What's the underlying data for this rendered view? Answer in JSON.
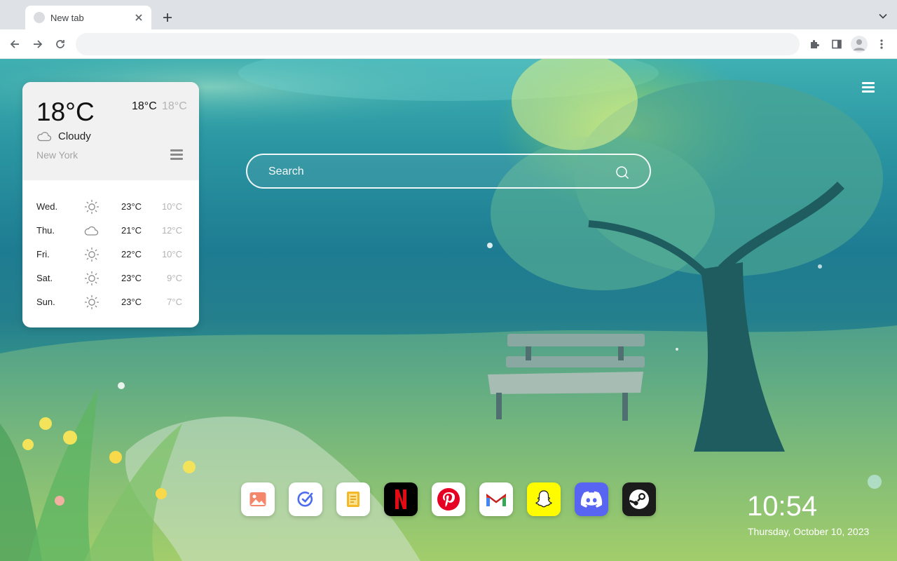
{
  "browser": {
    "tab_title": "New tab",
    "omnibox_value": "",
    "omnibox_placeholder": ""
  },
  "weather": {
    "current_temp": "18°C",
    "high": "18°C",
    "low": "18°C",
    "condition": "Cloudy",
    "condition_icon": "cloud-icon",
    "city": "New York",
    "forecast": [
      {
        "day": "Wed.",
        "icon": "sun-icon",
        "high": "23°C",
        "low": "10°C"
      },
      {
        "day": "Thu.",
        "icon": "cloud-icon",
        "high": "21°C",
        "low": "12°C"
      },
      {
        "day": "Fri.",
        "icon": "sun-icon",
        "high": "22°C",
        "low": "10°C"
      },
      {
        "day": "Sat.",
        "icon": "sun-icon",
        "high": "23°C",
        "low": "9°C"
      },
      {
        "day": "Sun.",
        "icon": "sun-icon",
        "high": "23°C",
        "low": "7°C"
      }
    ]
  },
  "search": {
    "placeholder": "Search"
  },
  "dock": [
    {
      "name": "gallery",
      "icon": "image-icon",
      "bg": "#ffffff"
    },
    {
      "name": "tasks",
      "icon": "check-circle-icon",
      "bg": "#ffffff"
    },
    {
      "name": "notes",
      "icon": "note-icon",
      "bg": "#ffffff"
    },
    {
      "name": "netflix",
      "icon": "netflix-icon",
      "bg": "#000000"
    },
    {
      "name": "pinterest",
      "icon": "pinterest-icon",
      "bg": "#ffffff"
    },
    {
      "name": "gmail",
      "icon": "gmail-icon",
      "bg": "#ffffff"
    },
    {
      "name": "snapchat",
      "icon": "snapchat-icon",
      "bg": "#fffc00"
    },
    {
      "name": "discord",
      "icon": "discord-icon",
      "bg": "#5865f2"
    },
    {
      "name": "steam",
      "icon": "steam-icon",
      "bg": "#1b1b1b"
    }
  ],
  "clock": {
    "time": "10:54",
    "date": "Thursday, October 10, 2023"
  },
  "colors": {
    "accent_red": "#e50914",
    "pinterest_red": "#e60023",
    "discord": "#5865f2",
    "snap_yellow": "#fffc00"
  }
}
